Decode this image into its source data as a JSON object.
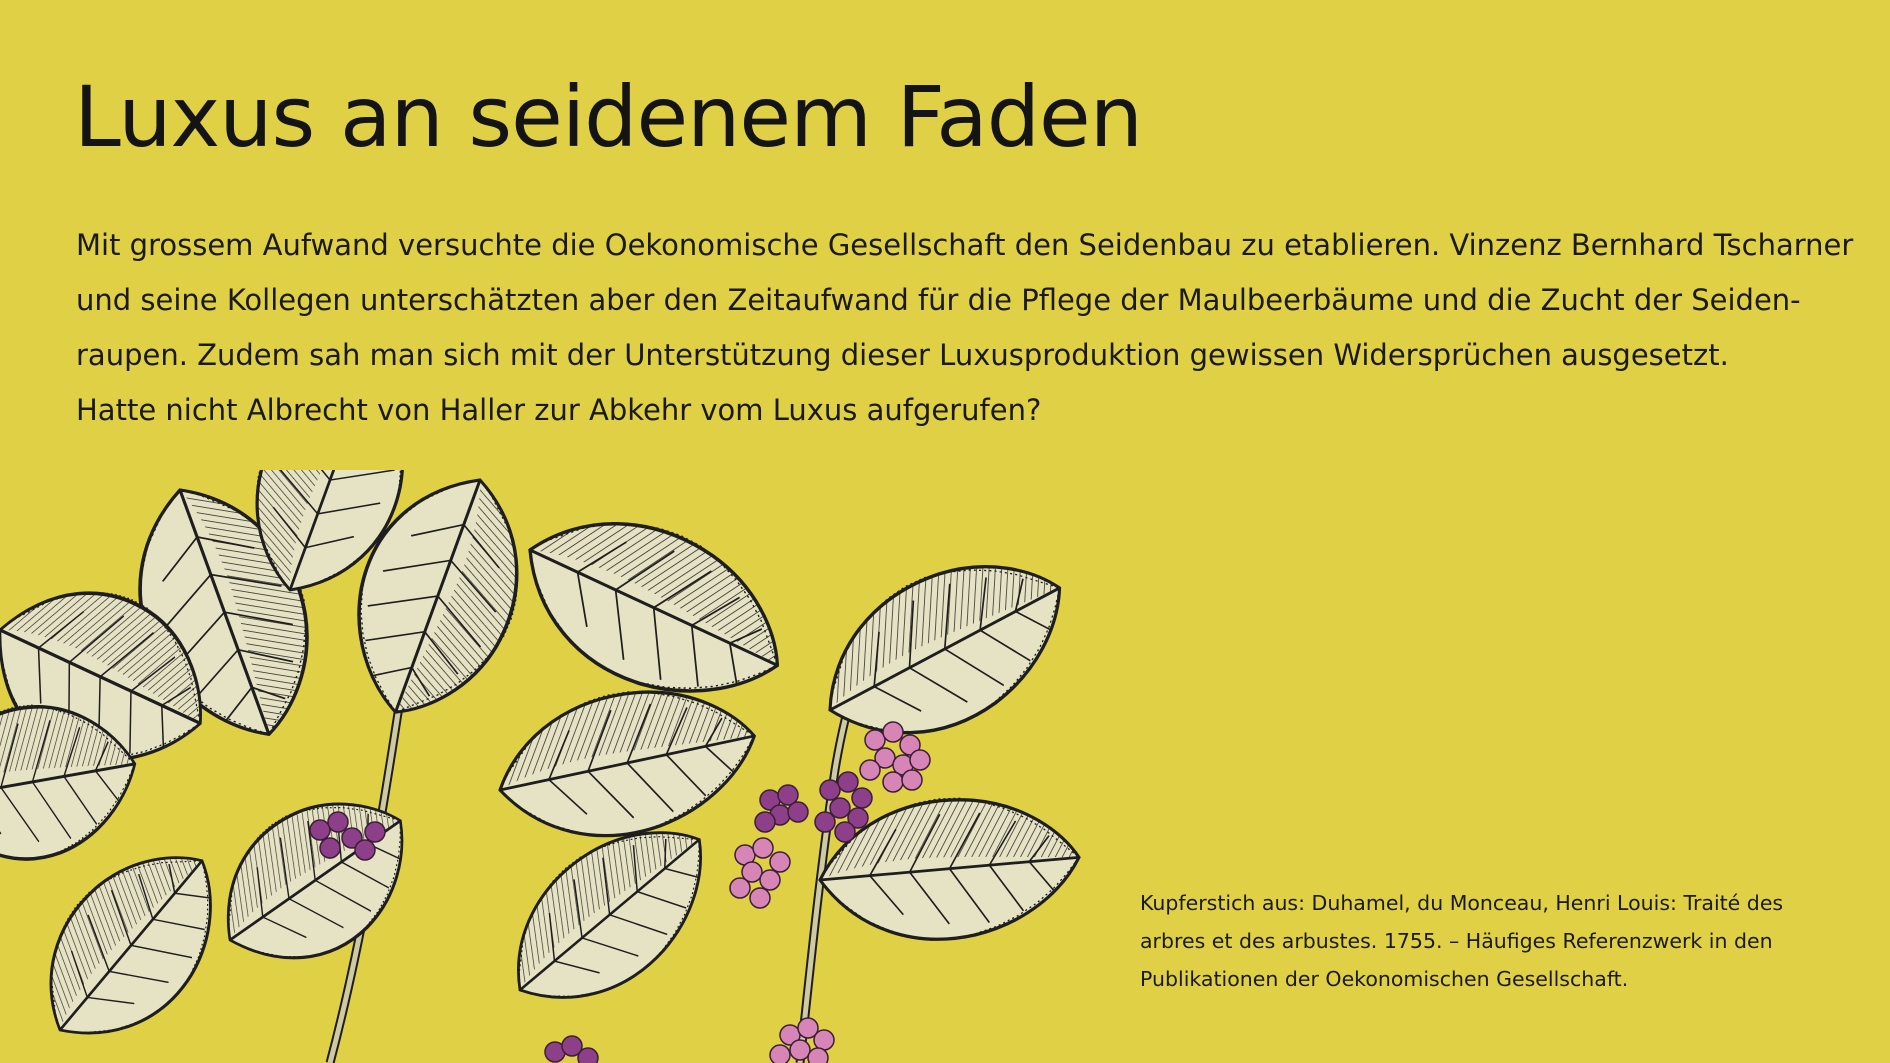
{
  "title": "Luxus an seidenem Faden",
  "body_lines": [
    "Mit grossem Aufwand versuchte die Oekonomische Gesellschaft den Seidenbau zu etablieren. Vinzenz Bernhard Tscharner",
    "und seine Kollegen unterschätzten aber den Zeitaufwand für die Pflege der Maulbeerbäume und die Zucht der Seiden-",
    "raupen. Zudem sah man sich mit der Unterstützung dieser Luxusproduktion gewissen Widersprüchen ausgesetzt.",
    "Hatte nicht Albrecht von Haller zur Abkehr vom Luxus aufgerufen?"
  ],
  "caption_lines": [
    "Kupferstich aus: Duhamel, du Monceau, Henri Louis: Traité des",
    "arbres et des arbustes. 1755. – Häufiges Referenzwerk in den",
    "Publikationen der Oekonomischen Gesellschaft."
  ],
  "colors": {
    "background": "#e0d046",
    "text": "#141414",
    "leaf_fill": "#e6e2c4",
    "leaf_stroke": "#1e1e1e",
    "berry_pink": "#d784b6",
    "berry_purple": "#8e3f8a"
  },
  "illustration": {
    "icon": "mulberry-branch-engraving"
  }
}
